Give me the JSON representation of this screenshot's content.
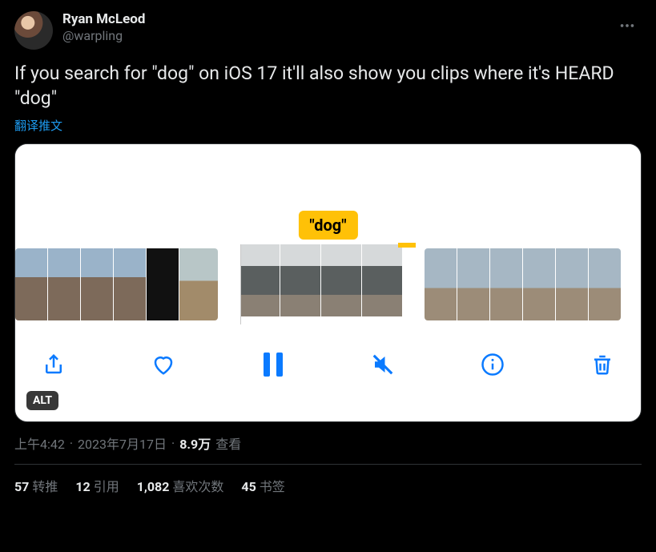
{
  "author": {
    "display_name": "Ryan McLeod",
    "handle": "@warpling"
  },
  "tweet_text": "If you search for \"dog\" on iOS 17 it'll also show you clips where it's HEARD \"dog\"",
  "translate_label": "翻译推文",
  "media": {
    "highlight_label": "\"dog\"",
    "alt_badge": "ALT",
    "toolbar": {
      "share": "share",
      "like": "like",
      "pause": "pause",
      "mute": "mute",
      "info": "info",
      "delete": "delete"
    }
  },
  "meta": {
    "time": "上午4:42",
    "date": "2023年7月17日",
    "views_count": "8.9万",
    "views_label": "查看"
  },
  "stats": {
    "retweets_count": "57",
    "retweets_label": "转推",
    "quotes_count": "12",
    "quotes_label": "引用",
    "likes_count": "1,082",
    "likes_label": "喜欢次数",
    "bookmarks_count": "45",
    "bookmarks_label": "书签"
  }
}
